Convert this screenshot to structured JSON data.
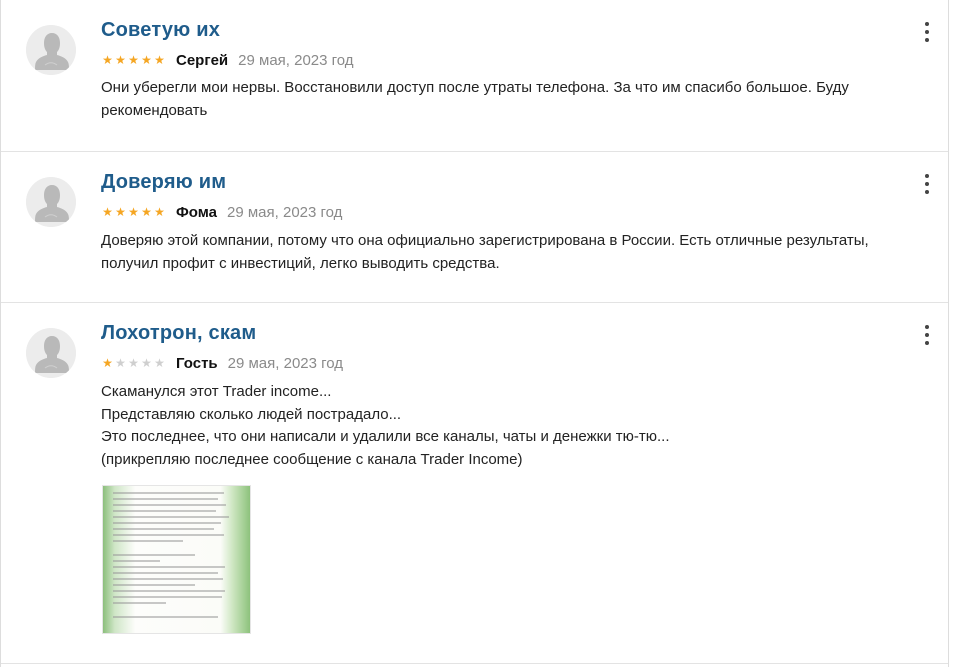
{
  "reviews": [
    {
      "title": "Советую их",
      "author": "Сергей",
      "date": "29 мая, 2023 год",
      "rating": 5,
      "text": [
        "Они уберегли мои нервы. Восстановили доступ после утраты телефона. За что им спасибо большое. Буду рекомендовать"
      ]
    },
    {
      "title": "Доверяю им",
      "author": "Фома",
      "date": "29 мая, 2023 год",
      "rating": 5,
      "text": [
        "Доверяю этой компании, потому что она официально зарегистрирована в России. Есть отличные результаты, получил профит с инвестиций, легко выводить средства."
      ]
    },
    {
      "title": "Лохотрон, скам",
      "author": "Гость",
      "date": "29 мая, 2023 год",
      "rating": 1,
      "text": [
        "Скаманулся этот Trader income...",
        "Представляю сколько людей пострадало...",
        "Это последнее, что они написали и удалили все каналы, чаты и денежки тю-тю...",
        "(прикрепляю последнее сообщение с канала Trader Income)"
      ],
      "attachment_icon": "image-thumbnail"
    }
  ],
  "colors": {
    "title": "#1f5c8b",
    "star_on": "#f5a623",
    "star_off": "#cfcfcf",
    "date": "#8a8a8a"
  },
  "icons": {
    "avatar": "user-silhouette-icon",
    "menu": "more-vertical-icon",
    "star": "star-icon"
  }
}
